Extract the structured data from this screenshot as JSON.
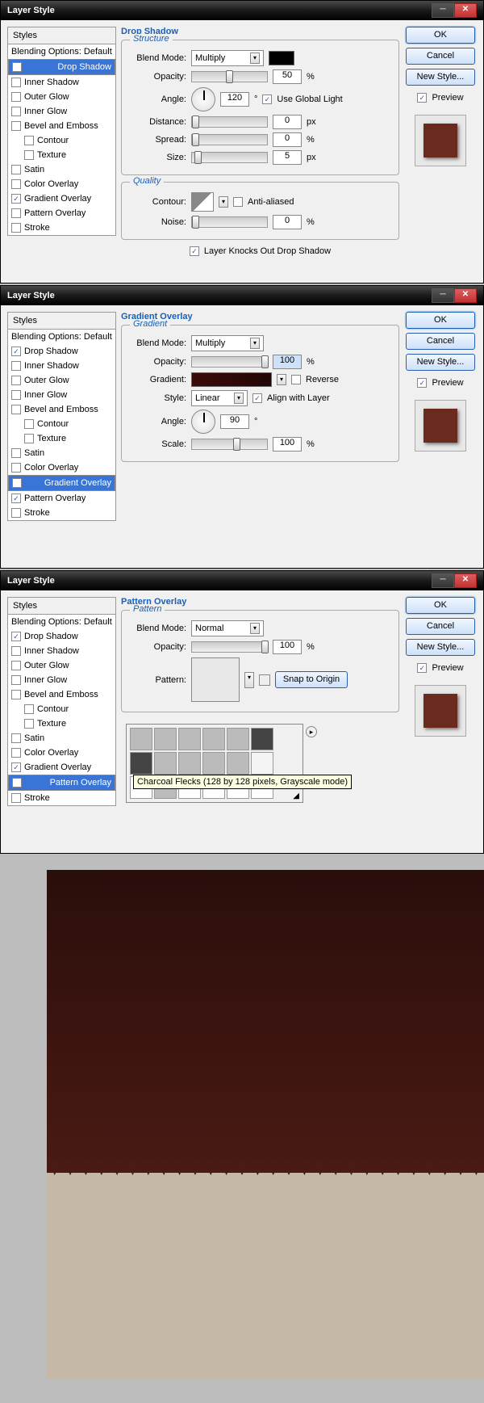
{
  "dialogs": [
    {
      "title": "Layer Style",
      "section_title": "Drop Shadow",
      "selected": "Drop Shadow",
      "checked": [
        "Drop Shadow",
        "Gradient Overlay"
      ],
      "structure": {
        "legend": "Structure",
        "blend_label": "Blend Mode:",
        "blend_value": "Multiply",
        "opacity_label": "Opacity:",
        "opacity_value": "50",
        "angle_label": "Angle:",
        "angle_value": "120",
        "deg": "°",
        "global_label": "Use Global Light",
        "distance_label": "Distance:",
        "distance_value": "0",
        "px": "px",
        "spread_label": "Spread:",
        "spread_value": "0",
        "pct": "%",
        "size_label": "Size:",
        "size_value": "5"
      },
      "quality": {
        "legend": "Quality",
        "contour_label": "Contour:",
        "aa_label": "Anti-aliased",
        "noise_label": "Noise:",
        "noise_value": "0",
        "pct": "%"
      },
      "knockout_label": "Layer Knocks Out Drop Shadow"
    },
    {
      "title": "Layer Style",
      "section_title": "Gradient Overlay",
      "selected": "Gradient Overlay",
      "checked": [
        "Drop Shadow",
        "Gradient Overlay",
        "Pattern Overlay"
      ],
      "gradient": {
        "legend": "Gradient",
        "blend_label": "Blend Mode:",
        "blend_value": "Multiply",
        "opacity_label": "Opacity:",
        "opacity_value": "100",
        "pct": "%",
        "gradient_label": "Gradient:",
        "reverse_label": "Reverse",
        "style_label": "Style:",
        "style_value": "Linear",
        "align_label": "Align with Layer",
        "angle_label": "Angle:",
        "angle_value": "90",
        "deg": "°",
        "scale_label": "Scale:",
        "scale_value": "100"
      }
    },
    {
      "title": "Layer Style",
      "section_title": "Pattern Overlay",
      "selected": "Pattern Overlay",
      "checked": [
        "Drop Shadow",
        "Gradient Overlay",
        "Pattern Overlay"
      ],
      "pattern": {
        "legend": "Pattern",
        "blend_label": "Blend Mode:",
        "blend_value": "Normal",
        "opacity_label": "Opacity:",
        "opacity_value": "100",
        "pct": "%",
        "pattern_label": "Pattern:",
        "snap_label": "Snap to Origin",
        "tooltip": "Charcoal Flecks (128 by 128 pixels, Grayscale mode)"
      }
    }
  ],
  "styles": {
    "header": "Styles",
    "blending": "Blending Options: Default",
    "items": [
      "Drop Shadow",
      "Inner Shadow",
      "Outer Glow",
      "Inner Glow",
      "Bevel and Emboss",
      "Contour",
      "Texture",
      "Satin",
      "Color Overlay",
      "Gradient Overlay",
      "Pattern Overlay",
      "Stroke"
    ]
  },
  "buttons": {
    "ok": "OK",
    "cancel": "Cancel",
    "new_style": "New Style...",
    "preview": "Preview"
  }
}
